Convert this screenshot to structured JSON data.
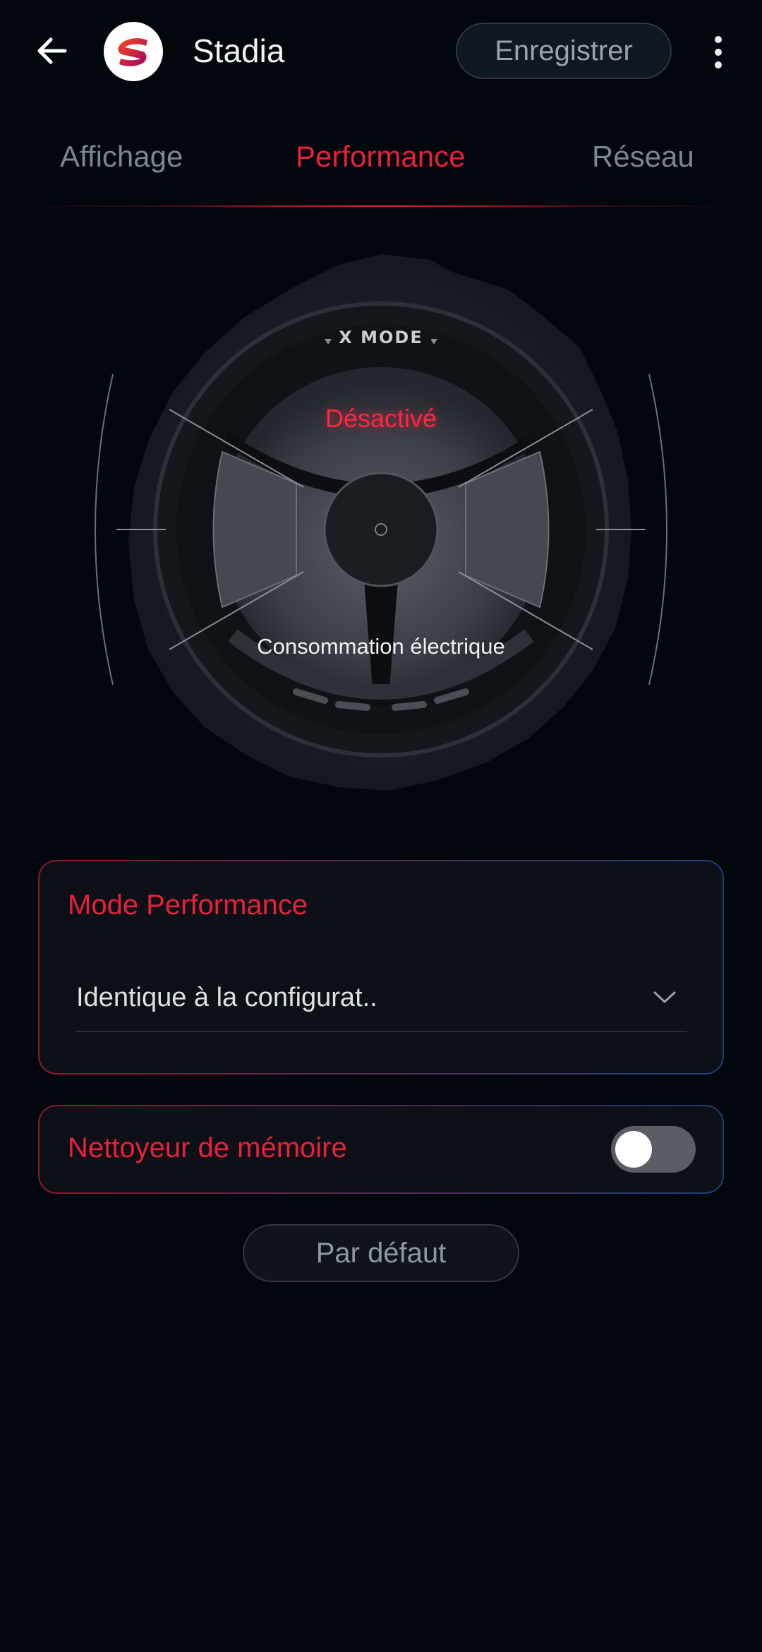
{
  "header": {
    "title": "Stadia",
    "save_label": "Enregistrer",
    "icons": {
      "back": "arrow-left-icon",
      "app": "stadia-logo-icon",
      "more": "more-vert-icon"
    }
  },
  "tabs": [
    {
      "label": "Affichage",
      "active": false
    },
    {
      "label": "Performance",
      "active": true
    },
    {
      "label": "Réseau",
      "active": false
    }
  ],
  "dial": {
    "logo_text": "X MODE",
    "state": "Désactivé",
    "caption": "Consommation électrique"
  },
  "performance_mode": {
    "title": "Mode Performance",
    "selected_value": "Identique à la configurat.."
  },
  "memory_cleaner": {
    "title": "Nettoyeur de mémoire",
    "enabled": false
  },
  "default_button": {
    "label": "Par défaut"
  },
  "colors": {
    "accent": "#e8213b",
    "background": "#02060d",
    "card": "#0d1117",
    "muted": "#7d8590"
  }
}
